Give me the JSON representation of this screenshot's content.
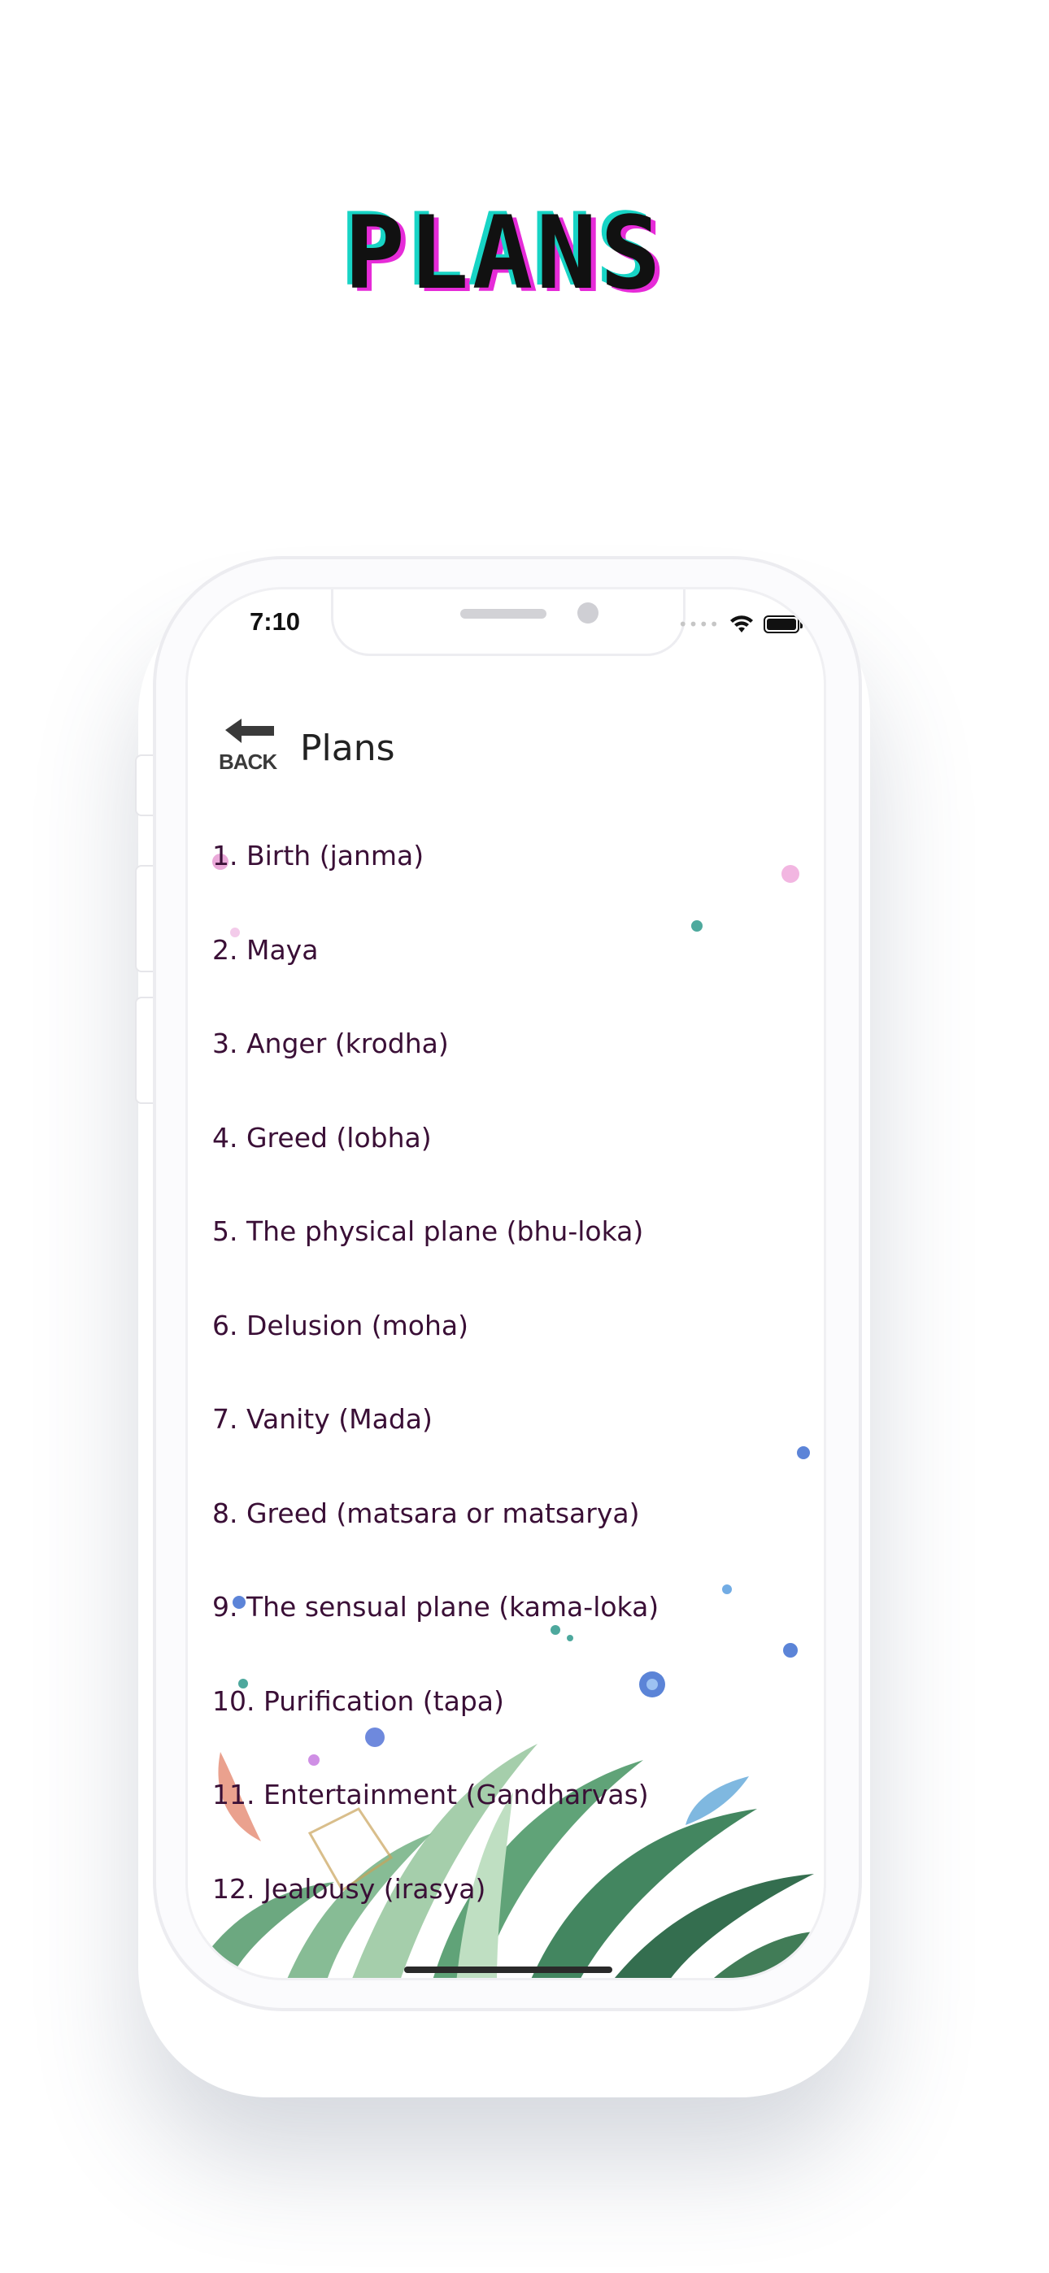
{
  "poster": {
    "title": "PLANS"
  },
  "status_bar": {
    "time": "7:10",
    "signal_icon": "signal-dots-icon",
    "wifi_icon": "wifi-icon",
    "battery_icon": "battery-icon",
    "battery_level": 1.0
  },
  "header": {
    "back_label": "BACK",
    "back_icon": "arrow-left-icon",
    "title": "Plans"
  },
  "plans": [
    "1. Birth (janma)",
    "2. Maya",
    "3. Anger (krodha)",
    "4. Greed (lobha)",
    "5. The physical plane (bhu-loka)",
    "6. Delusion (moha)",
    "7. Vanity (Mada)",
    "8. Greed (matsara or matsarya)",
    "9. The sensual plane (kama-loka)",
    "10. Purification (tapa)",
    "11. Entertainment (Gandharvas)",
    "12. Jealousy (irasya)"
  ],
  "colors": {
    "list_text": "#3a0f36",
    "title_cyan": "#17d4c5",
    "title_magenta": "#e62bd8",
    "leaf_green": "#3f8f5e",
    "flower_blue": "#3f6fd1",
    "flower_pink": "#e79bd3"
  }
}
